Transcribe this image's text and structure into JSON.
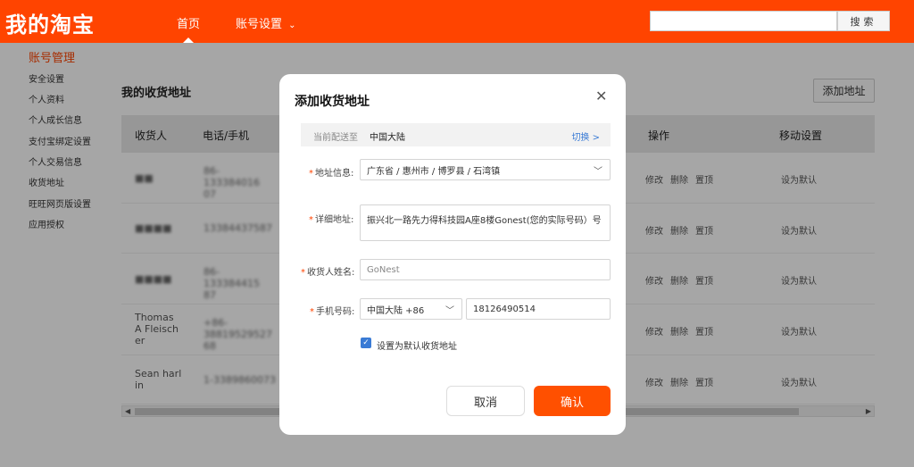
{
  "header": {
    "logo": "我的淘宝",
    "nav_home": "首页",
    "nav_account": "账号设置",
    "nav_account_caret": "⌄",
    "search_placeholder": "",
    "search_button": "搜索",
    "brand_color": "#ff4400"
  },
  "sidebar": {
    "title": "账号管理",
    "items": [
      {
        "label": "安全设置"
      },
      {
        "label": "个人资料"
      },
      {
        "label": "个人成长信息"
      },
      {
        "label": "支付宝绑定设置"
      },
      {
        "label": "个人交易信息"
      },
      {
        "label": "收货地址"
      },
      {
        "label": "旺旺网页版设置"
      },
      {
        "label": "应用授权"
      }
    ]
  },
  "main": {
    "title": "我的收货地址",
    "add_button": "添加地址",
    "table": {
      "headers": {
        "receiver": "收货人",
        "phone": "电话/手机",
        "ops": "操作",
        "move": "移动设置"
      },
      "rows": [
        {
          "receiver": "■■",
          "phone": "86-133384016 07",
          "edit": "修改",
          "delete": "删除",
          "top": "置顶",
          "set_default": "设为默认"
        },
        {
          "receiver": "■■■■",
          "phone": "13384437587",
          "edit": "修改",
          "delete": "删除",
          "top": "置顶",
          "set_default": "设为默认"
        },
        {
          "receiver": "■■■■",
          "phone": "86-133384415 87",
          "edit": "修改",
          "delete": "删除",
          "top": "置顶",
          "set_default": "设为默认"
        },
        {
          "receiver": "Thomas A Fleischer",
          "phone": "+86-38819529527 68",
          "edit": "修改",
          "delete": "删除",
          "top": "置顶",
          "set_default": "设为默认"
        },
        {
          "receiver": "Sean harlin",
          "phone": "1-3389860073",
          "edit": "修改",
          "delete": "删除",
          "top": "置顶",
          "set_default": "设为默认"
        }
      ]
    }
  },
  "modal": {
    "title": "添加收货地址",
    "close_icon": "close-icon",
    "region_label": "当前配送至",
    "region_value": "中国大陆",
    "region_switch": "切换 >",
    "address_label": "地址信息:",
    "address_value": "广东省 / 惠州市 / 博罗县 / 石湾镇",
    "detail_label": "详细地址:",
    "detail_value": "振兴北一路先力得科技园A座8楼Gonest(您的实际号码）号",
    "name_label": "收货人姓名:",
    "name_value": "GoNest",
    "phone_label": "手机号码:",
    "phone_country": "中国大陆 +86",
    "phone_value": "18126490514",
    "default_checkbox_label": "设置为默认收货地址",
    "default_checked": true,
    "cancel_button": "取消",
    "confirm_button": "确认",
    "confirm_color": "#ff5000",
    "check_color": "#3a7bd5"
  }
}
